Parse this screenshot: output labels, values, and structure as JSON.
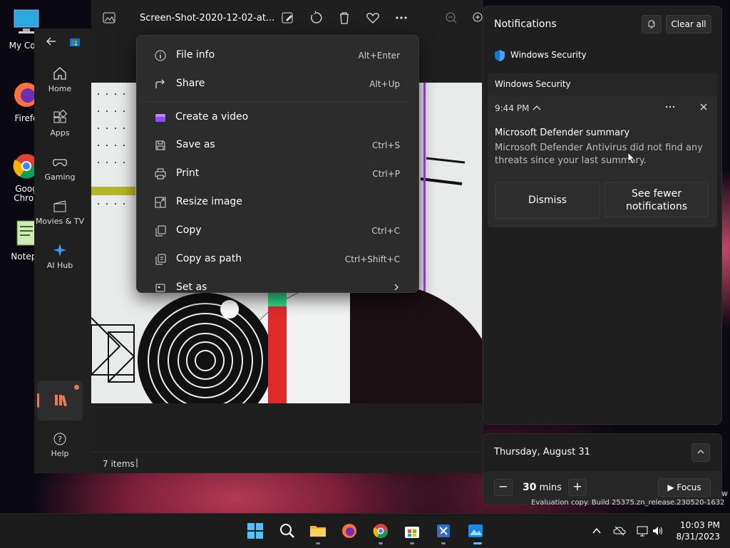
{
  "desktop": {
    "icons": [
      {
        "label": "My Com",
        "icon": "monitor-icon"
      },
      {
        "label": "Firefo",
        "icon": "firefox-icon"
      },
      {
        "label": "Goog Chron",
        "icon": "chrome-icon"
      },
      {
        "label": "Notepa",
        "icon": "notepad-icon"
      }
    ],
    "watermark_w": "w",
    "watermark": "Evaluation copy. Build 25375.zn_release.230520-1632"
  },
  "store_sidebar": {
    "items": [
      {
        "label": "Home",
        "icon": "home-icon"
      },
      {
        "label": "Apps",
        "icon": "apps-icon"
      },
      {
        "label": "Gaming",
        "icon": "gamepad-icon"
      },
      {
        "label": "Movies & TV",
        "icon": "film-icon"
      },
      {
        "label": "AI Hub",
        "icon": "ai-sparkle-icon"
      }
    ],
    "help_label": "Help"
  },
  "photos": {
    "filename": "Screen-Shot-2020-12-02-at...",
    "status": "7 items",
    "status_sep": "|"
  },
  "context_menu": {
    "items": [
      {
        "label": "File info",
        "shortcut": "Alt+Enter",
        "icon": "info-icon"
      },
      {
        "label": "Share",
        "shortcut": "Alt+Up",
        "icon": "share-icon"
      },
      {
        "label": "Create a video",
        "shortcut": "",
        "icon": "clipchamp-icon"
      },
      {
        "label": "Save as",
        "shortcut": "Ctrl+S",
        "icon": "save-icon"
      },
      {
        "label": "Print",
        "shortcut": "Ctrl+P",
        "icon": "print-icon"
      },
      {
        "label": "Resize image",
        "shortcut": "",
        "icon": "resize-icon"
      },
      {
        "label": "Copy",
        "shortcut": "Ctrl+C",
        "icon": "copy-icon"
      },
      {
        "label": "Copy as path",
        "shortcut": "Ctrl+Shift+C",
        "icon": "copy-path-icon"
      },
      {
        "label": "Set as",
        "shortcut": "",
        "icon": "set-as-icon"
      }
    ]
  },
  "notifications": {
    "title": "Notifications",
    "clear_all": "Clear all",
    "group_app": "Windows Security",
    "card_header": "Windows Security",
    "time": "9:44 PM",
    "notif_title": "Microsoft Defender summary",
    "notif_body": "Microsoft Defender Antivirus did not find any threats since your last summary.",
    "dismiss": "Dismiss",
    "see_fewer": "See fewer notifications"
  },
  "calendar": {
    "date": "Thursday, August 31",
    "focus_value": "30",
    "focus_unit": "mins",
    "focus_label": "Focus"
  },
  "taskbar": {
    "time": "10:03 PM",
    "date": "8/31/2023"
  },
  "colors": {
    "accent": "#60cdff",
    "security_blue": "#1a73d9"
  }
}
